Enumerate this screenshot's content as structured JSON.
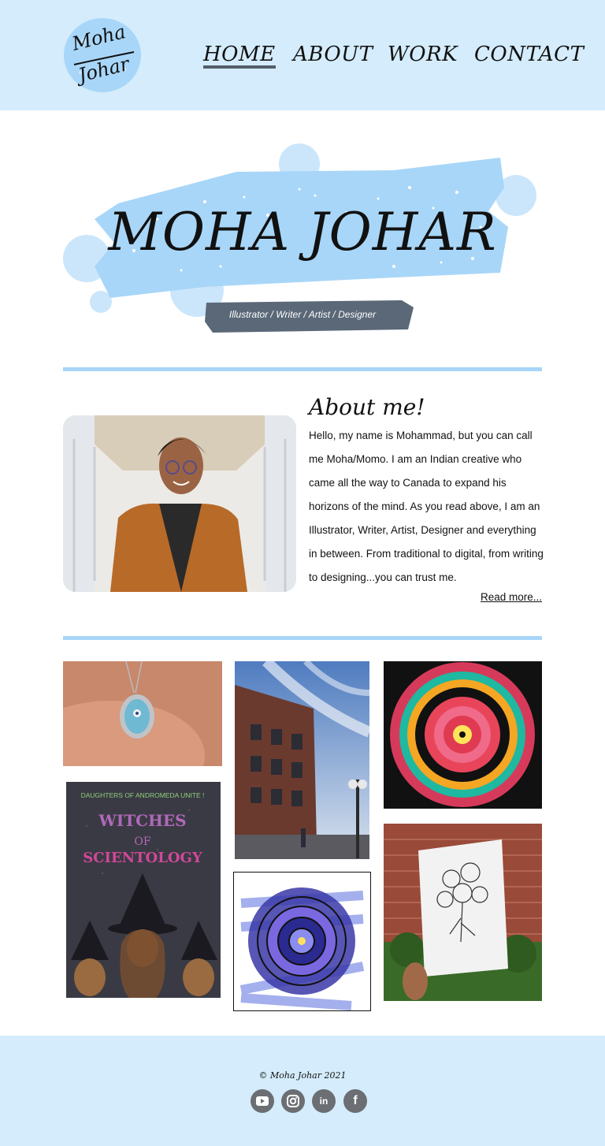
{
  "brand": {
    "logo_text_line1": "Moha",
    "logo_text_line2": "Johar"
  },
  "nav": {
    "items": [
      {
        "label": "HOME",
        "active": true
      },
      {
        "label": "ABOUT",
        "active": false
      },
      {
        "label": "WORK",
        "active": false
      },
      {
        "label": "CONTACT",
        "active": false
      }
    ]
  },
  "hero": {
    "title": "MOHA JOHAR",
    "subtitle": "Illustrator / Writer / Artist / Designer"
  },
  "about": {
    "heading": "About me!",
    "body": "Hello, my name is Mohammad, but you can call me Moha/Momo. I am an Indian creative who came all the way to Canada to expand his horizons of the mind. As you read above, I am an Illustrator, Writer, Artist, Designer and everything in between. From traditional to digital, from writing to designing...you can trust me.",
    "read_more": "Read more..."
  },
  "gallery": {
    "poster_line1": "DAUGHTERS OF ANDROMEDA UNITE !",
    "poster_line2": "WITCHES",
    "poster_line3": "OF",
    "poster_line4": "SCIENTOLOGY"
  },
  "footer": {
    "copyright": "© Moha Johar 2021",
    "social": [
      {
        "icon": "youtube-icon"
      },
      {
        "icon": "instagram-icon"
      },
      {
        "icon": "linkedin-icon",
        "label": "in"
      },
      {
        "icon": "facebook-icon",
        "label": "f"
      }
    ]
  },
  "colors": {
    "header_bg": "#d4ecfb",
    "accent": "#a8d6f8",
    "slate": "#555e6a"
  }
}
